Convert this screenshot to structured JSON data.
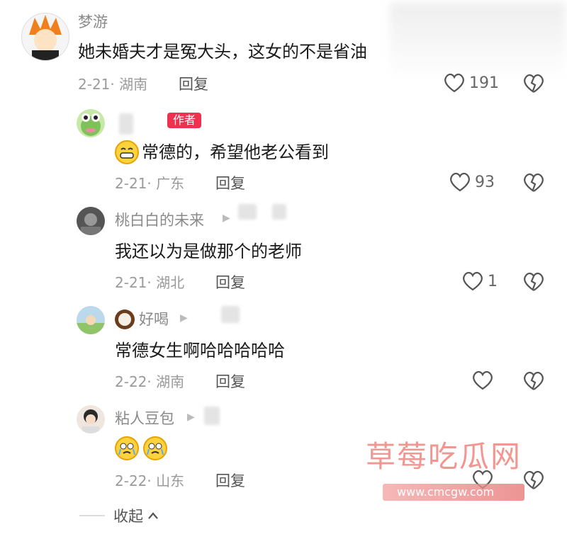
{
  "comments": [
    {
      "name": "梦游",
      "text": "她未婚夫才是冤大头，这女的不是省油",
      "date": "2-21· 湖南",
      "reply": "回复",
      "likes": "191"
    },
    {
      "name": "",
      "badge": "作者",
      "text": "常德的，希望他老公看到",
      "date": "2-21· 广东",
      "reply": "回复",
      "likes": "93"
    },
    {
      "name": "桃白白的未来",
      "text": "我还以为是做那个的老师",
      "date": "2-21· 湖北",
      "reply": "回复",
      "likes": "1"
    },
    {
      "name": "好喝",
      "text": "常德女生啊哈哈哈哈哈",
      "date": "2-22· 湖南",
      "reply": "回复",
      "likes": ""
    },
    {
      "name": "粘人豆包",
      "text": "",
      "date": "2-22· 山东",
      "reply": "回复",
      "likes": ""
    }
  ],
  "collapse": {
    "label": "收起"
  },
  "watermark": {
    "title": "草莓吃瓜网",
    "url": "www.cmcgw.com",
    "color": "#e8423a"
  }
}
